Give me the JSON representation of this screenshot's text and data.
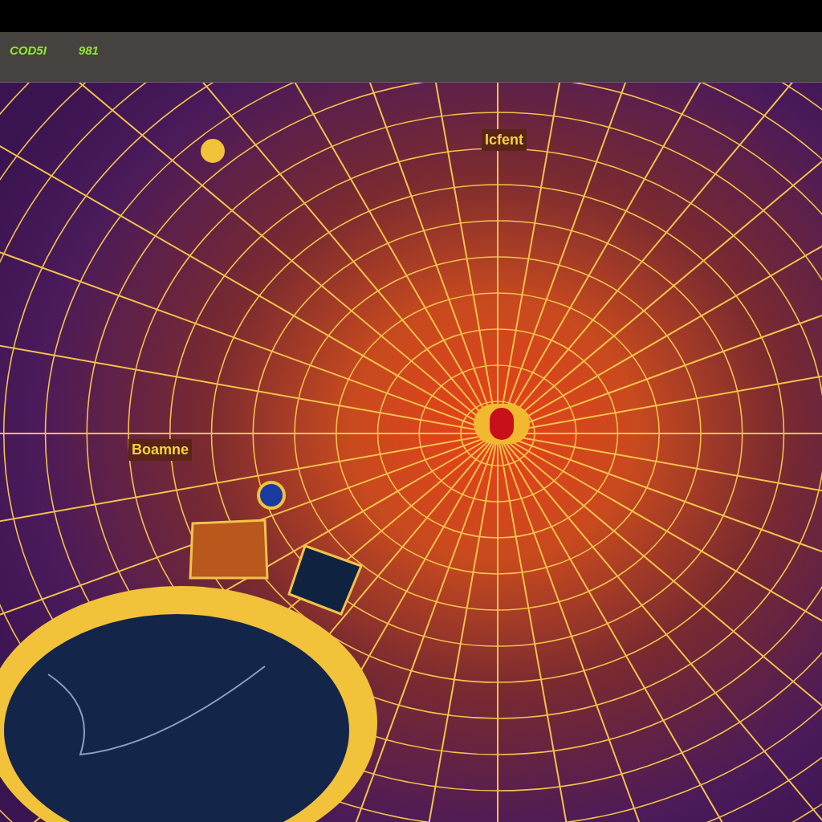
{
  "toolbar": {
    "items": [
      {
        "label": "COD5I"
      },
      {
        "label": "981"
      }
    ]
  },
  "map": {
    "labels": [
      {
        "text": "Icfent"
      },
      {
        "text": "Boamne"
      }
    ]
  }
}
